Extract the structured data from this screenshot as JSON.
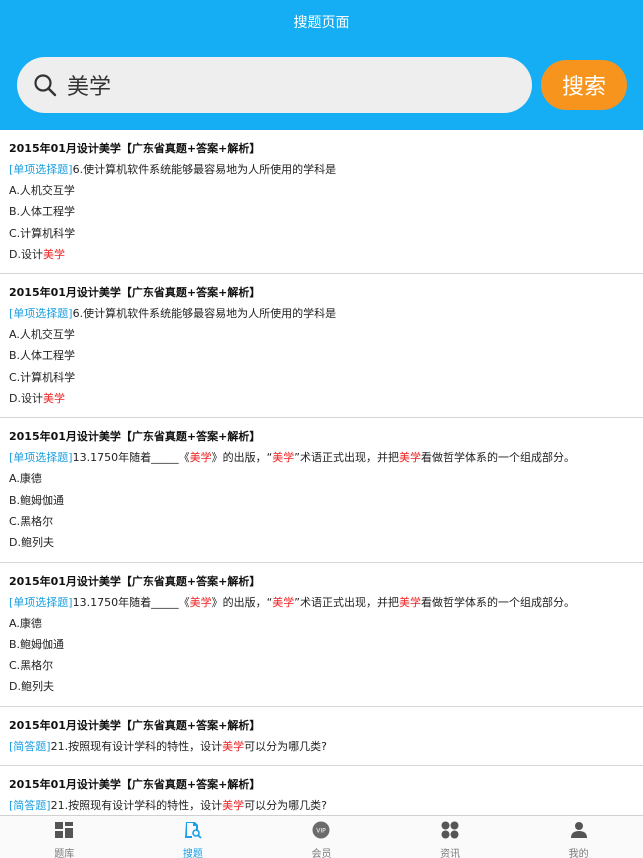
{
  "header": {
    "title": "搜题页面"
  },
  "search": {
    "value": "美学",
    "button_label": "搜索"
  },
  "results": [
    {
      "title": "2015年01月设计美学【广东省真题+答案+解析】",
      "type": "[单项选择题]",
      "question": [
        "6.使计算机软件系统能够最容易地为人所使用的学科是"
      ],
      "options": [
        [
          "A.人机交互学"
        ],
        [
          "B.人体工程学"
        ],
        [
          "C.计算机科学"
        ],
        [
          "D.设计",
          {
            "hl": "美学"
          }
        ]
      ]
    },
    {
      "title": "2015年01月设计美学【广东省真题+答案+解析】",
      "type": "[单项选择题]",
      "question": [
        "6.使计算机软件系统能够最容易地为人所使用的学科是"
      ],
      "options": [
        [
          "A.人机交互学"
        ],
        [
          "B.人体工程学"
        ],
        [
          "C.计算机科学"
        ],
        [
          "D.设计",
          {
            "hl": "美学"
          }
        ]
      ]
    },
    {
      "title": "2015年01月设计美学【广东省真题+答案+解析】",
      "type": "[单项选择题]",
      "question": [
        "13.1750年随着_____《",
        {
          "hl": "美学"
        },
        "》的出版，“",
        {
          "hl": "美学"
        },
        "”术语正式出现，并把",
        {
          "hl": "美学"
        },
        "看做哲学体系的一个组成部分。"
      ],
      "options": [
        [
          "A.康德"
        ],
        [
          "B.鲍姆伽通"
        ],
        [
          "C.黑格尔"
        ],
        [
          "D.鲍列夫"
        ]
      ]
    },
    {
      "title": "2015年01月设计美学【广东省真题+答案+解析】",
      "type": "[单项选择题]",
      "question": [
        "13.1750年随着_____《",
        {
          "hl": "美学"
        },
        "》的出版，“",
        {
          "hl": "美学"
        },
        "”术语正式出现，并把",
        {
          "hl": "美学"
        },
        "看做哲学体系的一个组成部分。"
      ],
      "options": [
        [
          "A.康德"
        ],
        [
          "B.鲍姆伽通"
        ],
        [
          "C.黑格尔"
        ],
        [
          "D.鲍列夫"
        ]
      ]
    },
    {
      "title": "2015年01月设计美学【广东省真题+答案+解析】",
      "type": "[简答题]",
      "question": [
        "21.按照现有设计学科的特性，设计",
        {
          "hl": "美学"
        },
        "可以分为哪几类?"
      ],
      "options": []
    },
    {
      "title": "2015年01月设计美学【广东省真题+答案+解析】",
      "type": "[简答题]",
      "question": [
        "21.按照现有设计学科的特性，设计",
        {
          "hl": "美学"
        },
        "可以分为哪几类?"
      ],
      "options": []
    }
  ],
  "tabbar": {
    "tabs": [
      {
        "label": "题库",
        "icon": "grid-icon",
        "active": false
      },
      {
        "label": "搜题",
        "icon": "search-doc-icon",
        "active": true
      },
      {
        "label": "会员",
        "icon": "vip-icon",
        "active": false
      },
      {
        "label": "资讯",
        "icon": "news-icon",
        "active": false
      },
      {
        "label": "我的",
        "icon": "profile-icon",
        "active": false
      }
    ]
  },
  "colors": {
    "primary": "#15aef4",
    "accent": "#f7941d",
    "highlight": "#ee2222",
    "tag": "#1a9ee0"
  }
}
